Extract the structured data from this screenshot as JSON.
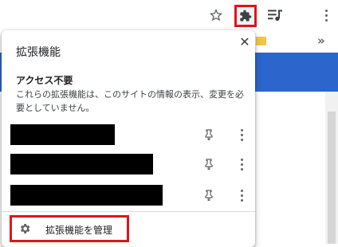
{
  "toolbar": {
    "icons": [
      "star-icon",
      "extensions-puzzle-icon",
      "playlist-icon",
      "more-vert-icon"
    ],
    "overflow_chevron": "»"
  },
  "popup": {
    "title": "拡張機能",
    "close_glyph": "✕",
    "section_heading": "アクセス不要",
    "section_description": "これらの拡張機能は、このサイトの情報の表示、変更を必要としていません。",
    "extensions": [
      {
        "name_redacted": true,
        "pinned": false
      },
      {
        "name_redacted": true,
        "pinned": false
      },
      {
        "name_redacted": true,
        "pinned": false
      }
    ],
    "manage_label": "拡張機能を管理"
  },
  "colors": {
    "highlight_red": "#e0141b",
    "page_blue": "#2c66cc",
    "redaction": "#000000"
  }
}
